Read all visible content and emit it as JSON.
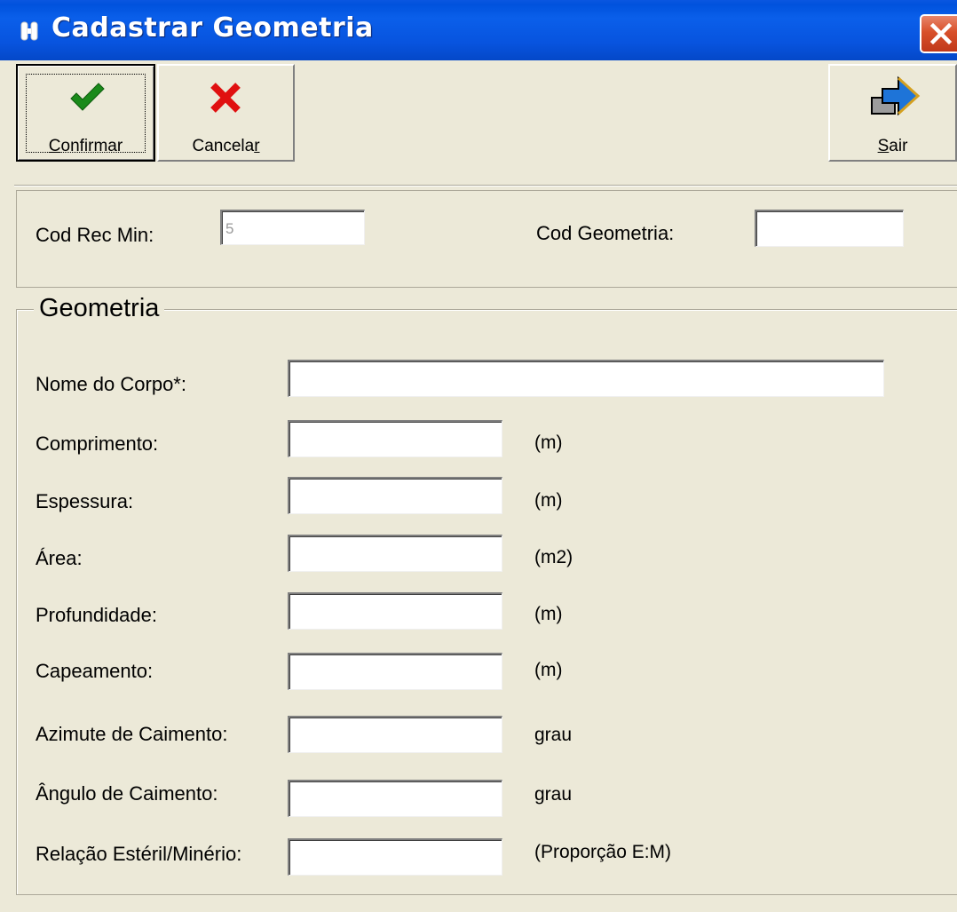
{
  "window": {
    "title": "Cadastrar Geometria",
    "title_icon": "app-icon",
    "close_icon": "close-icon",
    "titlebar_color": "#0a5fea",
    "close_color": "#d8502a",
    "background": "#ece9d8"
  },
  "toolbar": {
    "confirm_label": "Confirmar",
    "confirm_icon": "checkmark-icon",
    "confirm_color": "#1a8a1a",
    "cancel_label": "Cancelar",
    "cancel_icon": "x-icon",
    "cancel_color": "#e01010",
    "exit_label": "Sair",
    "exit_icon": "exit-arrow-icon"
  },
  "header_fields": {
    "cod_rec_min_label": "Cod Rec Min:",
    "cod_rec_min_value": "5",
    "cod_geometria_label": "Cod Geometria:",
    "cod_geometria_value": ""
  },
  "geometria": {
    "title": "Geometria",
    "fields": [
      {
        "label": "Nome do Corpo*:",
        "value": "",
        "unit": ""
      },
      {
        "label": "Comprimento:",
        "value": "",
        "unit": "(m)"
      },
      {
        "label": "Espessura:",
        "value": "",
        "unit": "(m)"
      },
      {
        "label": "Área:",
        "value": "",
        "unit": "(m2)"
      },
      {
        "label": "Profundidade:",
        "value": "",
        "unit": "(m)"
      },
      {
        "label": "Capeamento:",
        "value": "",
        "unit": "(m)"
      },
      {
        "label": "Azimute de Caimento:",
        "value": "",
        "unit": "grau"
      },
      {
        "label": "Ângulo de Caimento:",
        "value": "",
        "unit": "grau"
      },
      {
        "label": "Relação Estéril/Minério:",
        "value": "",
        "unit": "(Proporção E:M)"
      }
    ]
  }
}
